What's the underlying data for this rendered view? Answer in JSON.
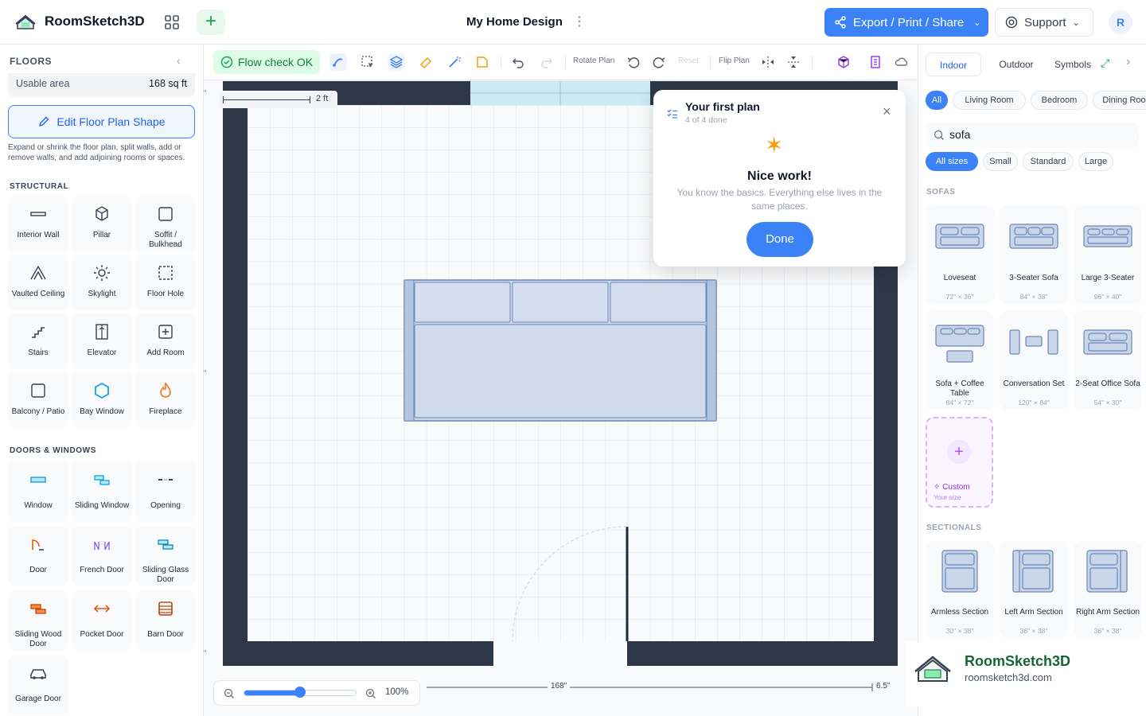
{
  "app": {
    "name": "RoomSketch3D",
    "document_title": "My Home Design",
    "export_label": "Export / Print / Share",
    "support_label": "Support",
    "avatar_initial": "R"
  },
  "left": {
    "header": "FLOORS",
    "usable_label": "Usable area",
    "usable_value": "168 sq ft",
    "edit_button": "Edit Floor Plan Shape",
    "edit_desc": "Expand or shrink the floor plan, split walls, add or remove walls, and add adjoining rooms or spaces.",
    "structural_title": "STRUCTURAL",
    "structural": [
      "Interior Wall",
      "Pillar",
      "Soffit / Bulkhead",
      "Vaulted Ceiling",
      "Skylight",
      "Floor Hole",
      "Stairs",
      "Elevator",
      "Add Room",
      "Balcony / Patio",
      "Bay Window",
      "Fireplace"
    ],
    "doors_title": "DOORS & WINDOWS",
    "doors": [
      "Window",
      "Sliding Window",
      "Opening",
      "Door",
      "French Door",
      "Sliding Glass Door",
      "Sliding Wood Door",
      "Pocket Door",
      "Barn Door",
      "Garage Door"
    ]
  },
  "toolbar": {
    "flow_check": "Flow check OK",
    "rotate_plan": "Rotate Plan",
    "reset": "Reset",
    "flip_plan": "Flip Plan"
  },
  "canvas": {
    "scale_label": "2 ft",
    "dim_bottom": "168\"",
    "dim_right": "6.5\"",
    "zoom": "100%",
    "zoom_fraction": 0.5
  },
  "popup": {
    "title": "Your first plan",
    "progress": "4 of 4 done",
    "heading": "Nice work!",
    "message": "You know the basics. Everything else lives in the same places.",
    "done_button": "Done"
  },
  "right": {
    "tabs": [
      "Indoor",
      "Outdoor",
      "Symbols"
    ],
    "rooms": [
      "All",
      "Living Room",
      "Bedroom",
      "Dining Room"
    ],
    "search_value": "sofa",
    "sizes": [
      "All sizes",
      "Small",
      "Standard",
      "Large"
    ],
    "sofas_title": "SOFAS",
    "sofas": [
      {
        "name": "Loveseat",
        "dims": "72\" × 36\""
      },
      {
        "name": "3-Seater Sofa",
        "dims": "84\" × 38\""
      },
      {
        "name": "Large 3-Seater",
        "dims": "96\" × 40\""
      },
      {
        "name": "Sofa + Coffee Table",
        "dims": "84\" × 72\""
      },
      {
        "name": "Conversation Set",
        "dims": "120\" × 84\""
      },
      {
        "name": "2-Seat Office Sofa",
        "dims": "54\" × 30\""
      }
    ],
    "custom_label": "Custom",
    "custom_sub": "Your size",
    "sectionals_title": "SECTIONALS",
    "sectionals": [
      {
        "name": "Armless Section",
        "dims": "30\" × 38\""
      },
      {
        "name": "Left Arm Section",
        "dims": "36\" × 38\""
      },
      {
        "name": "Right Arm Section",
        "dims": "36\" × 38\""
      }
    ]
  },
  "watermark": {
    "brand": "RoomSketch3D",
    "url": "roomsketch3d.com"
  }
}
